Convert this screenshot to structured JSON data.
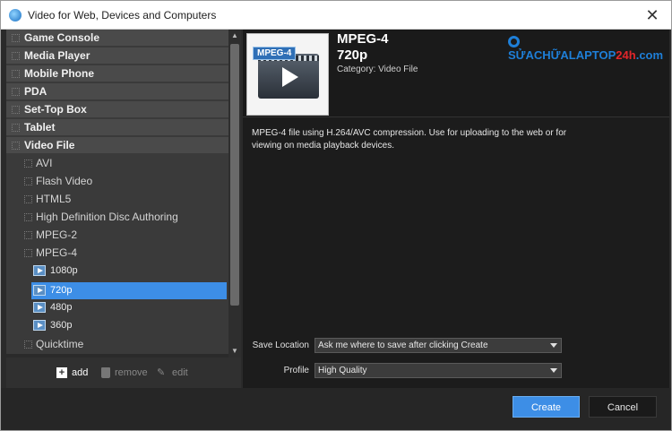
{
  "window": {
    "title": "Video for Web, Devices and Computers",
    "close_glyph": "✕"
  },
  "tree": {
    "categories": [
      {
        "label": "Game Console"
      },
      {
        "label": "Media Player"
      },
      {
        "label": "Mobile Phone"
      },
      {
        "label": "PDA"
      },
      {
        "label": "Set-Top Box"
      },
      {
        "label": "Tablet"
      },
      {
        "label": "Video File"
      }
    ],
    "subcategories": [
      {
        "label": "AVI"
      },
      {
        "label": "Flash Video"
      },
      {
        "label": "HTML5"
      },
      {
        "label": "High Definition Disc Authoring"
      },
      {
        "label": "MPEG-2"
      },
      {
        "label": "MPEG-4"
      }
    ],
    "presets": [
      {
        "label": "1080p",
        "selected": false
      },
      {
        "label": "720p",
        "selected": true
      },
      {
        "label": "480p",
        "selected": false
      },
      {
        "label": "360p",
        "selected": false
      }
    ],
    "after": {
      "label": "Quicktime"
    }
  },
  "toolbar": {
    "add_label": "add",
    "remove_label": "remove",
    "edit_label": "edit"
  },
  "detail": {
    "thumb_tag": "MPEG-4",
    "format": "MPEG-4",
    "resolution": "720p",
    "category": "Category: Video File",
    "description_line1": "MPEG-4 file using H.264/AVC compression. Use for uploading to the web or for",
    "description_line2": "viewing on media playback devices."
  },
  "watermark": {
    "text_blue": "SỬACHỮALAPTOP",
    "text_red": "24h",
    "text_tail": ".com"
  },
  "form": {
    "save_location_label": "Save Location",
    "save_location_value": "Ask me where to save after clicking Create",
    "profile_label": "Profile",
    "profile_value": "High Quality"
  },
  "buttons": {
    "create": "Create",
    "cancel": "Cancel"
  },
  "colors": {
    "accent": "#3d8ee6",
    "panel_bg": "#1c1c1c",
    "tree_bg": "#3a3a3a"
  }
}
